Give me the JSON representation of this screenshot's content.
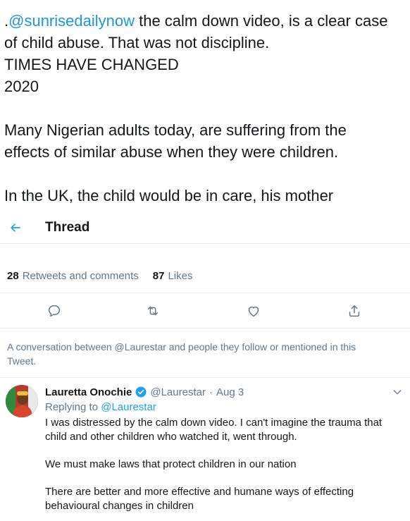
{
  "tweet": {
    "mention": "@sunrisedailynow",
    "line1_prefix": ".",
    "line1_rest": " the calm down video, is a clear case",
    "line2": "of child abuse. That was not discipline.",
    "line3": "TIMES HAVE CHANGED",
    "line4": "2020",
    "line5": "Many Nigerian adults today, are suffering from the",
    "line6": "effects of similar abuse when they were children.",
    "line7": "In the UK, the child would be in care, his mother"
  },
  "thread": {
    "title": "Thread"
  },
  "stats": {
    "retweets_count": "28",
    "retweets_label": "Retweets and comments",
    "likes_count": "87",
    "likes_label": "Likes"
  },
  "actions": {
    "reply_icon": "comment-icon",
    "retweet_icon": "retweet-icon",
    "like_icon": "heart-icon",
    "share_icon": "share-icon"
  },
  "conversation_note": "A conversation between @Laurestar and people they follow or mentioned in this Tweet.",
  "reply": {
    "name": "Lauretta Onochie",
    "handle": "@Laurestar",
    "separator": "·",
    "date": "Aug 3",
    "replying_prefix": "Replying to",
    "replying_to": "@Laurestar",
    "para1": "I was distressed by the calm down video. I can't imagine the trauma that child and other children who watched it, went through.",
    "para2": "We must make laws that protect children in our nation",
    "para3": "There are better and more effective and humane ways of effecting behavioural changes in children"
  },
  "colors": {
    "accent": "#1da1f2",
    "mention": "#1b95e0",
    "muted": "#657786",
    "border": "#e6ecf0"
  }
}
